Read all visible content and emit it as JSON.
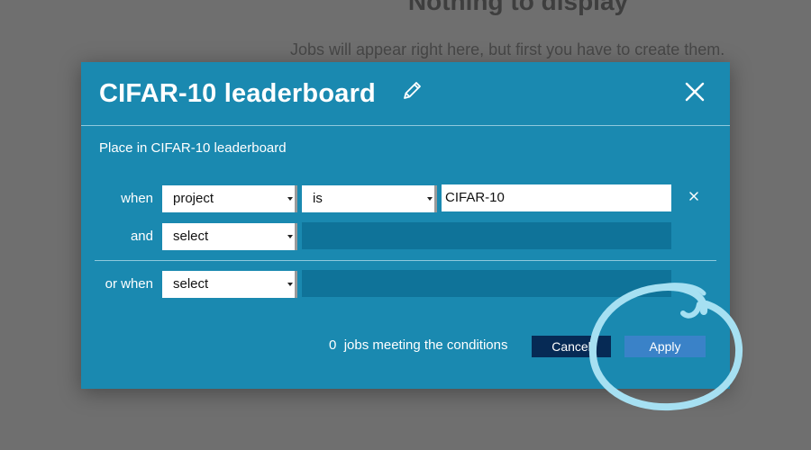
{
  "background": {
    "heading": "Nothing to display",
    "subtext": "Jobs will appear right here, but first you have to create them."
  },
  "dialog": {
    "title": "CIFAR-10 leaderboard",
    "subtitle": "Place in CIFAR-10 leaderboard",
    "icons": [
      "pencil-icon",
      "close-icon",
      "remove-condition-icon",
      "highlight-circle"
    ],
    "conditions": {
      "when_label": "when",
      "and_label": "and",
      "or_when_label": "or when",
      "row1": {
        "field": "project",
        "operator": "is",
        "value": "CIFAR-10"
      },
      "row2": {
        "field": "select"
      },
      "row3": {
        "field": "select"
      }
    },
    "footer": {
      "count": "0",
      "count_label": "jobs meeting the conditions",
      "cancel_label": "Cancel",
      "apply_label": "Apply"
    }
  },
  "colors": {
    "overlay": "#6f6f6f",
    "dialog_bg": "#1a89b0",
    "placeholder_field": "#0f7399",
    "cancel_bg": "#062a55",
    "apply_bg": "#3a82c8",
    "highlight": "#a6e0f2"
  }
}
